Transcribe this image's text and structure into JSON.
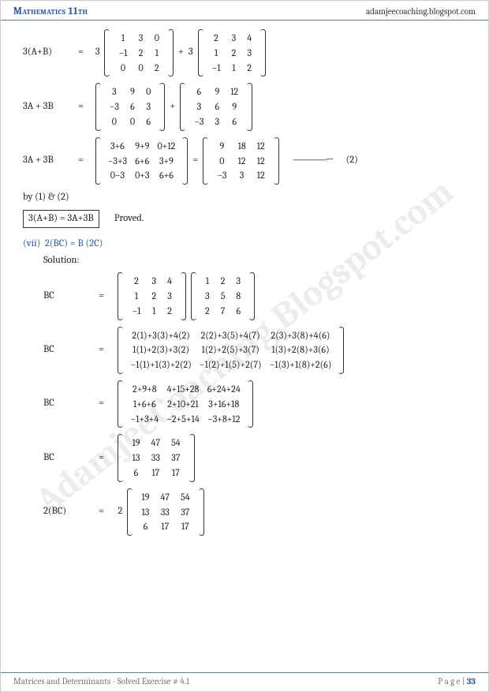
{
  "header": {
    "left": "Mathematics 11th",
    "right": "adamjeecoaching.blogspot.com"
  },
  "footer": {
    "chapter": "Matrices and Determinants",
    "sub": " - Solved Exercise # 4.1",
    "page_label": "P a g e | ",
    "page_no": "33"
  },
  "watermark": "AdamjeeCoaching.Blogspot.com",
  "eq1": {
    "lhs": "3(A+B)",
    "eq": "=",
    "s1": "3",
    "plus": "+",
    "s2": "3",
    "m1": [
      [
        "1",
        "3",
        "0"
      ],
      [
        "−1",
        "2",
        "1"
      ],
      [
        "0",
        "0",
        "2"
      ]
    ],
    "m2": [
      [
        "2",
        "3",
        "4"
      ],
      [
        "1",
        "2",
        "3"
      ],
      [
        "−1",
        "1",
        "2"
      ]
    ]
  },
  "eq2": {
    "lhs": "3A + 3B",
    "eq": "=",
    "plus": "+",
    "m1": [
      [
        "3",
        "9",
        "0"
      ],
      [
        "−3",
        "6",
        "3"
      ],
      [
        "0",
        "0",
        "6"
      ]
    ],
    "m2": [
      [
        "6",
        "9",
        "12"
      ],
      [
        "3",
        "6",
        "9"
      ],
      [
        "−3",
        "3",
        "6"
      ]
    ]
  },
  "eq3": {
    "lhs": "3A + 3B",
    "eq": "=",
    "eq2": "=",
    "arrow": "————→",
    "num": "(2)",
    "m1": [
      [
        "3+6",
        "9+9",
        "0+12"
      ],
      [
        "−3+3",
        "6+6",
        "3+9"
      ],
      [
        "0−3",
        "0+3",
        "6+6"
      ]
    ],
    "m2": [
      [
        "9",
        "18",
        "12"
      ],
      [
        "0",
        "12",
        "12"
      ],
      [
        "−3",
        "3",
        "12"
      ]
    ]
  },
  "line_by": "by (1) & (2)",
  "boxed": "3(A+B) = 3A+3B",
  "proved": "Proved.",
  "part": {
    "num": "(vii)",
    "stmt": "2(BC)  =  B (2C)",
    "sol": "Solution:"
  },
  "bc1": {
    "lhs": "BC",
    "eq": "=",
    "m1": [
      [
        "2",
        "3",
        "4"
      ],
      [
        "1",
        "2",
        "3"
      ],
      [
        "−1",
        "1",
        "2"
      ]
    ],
    "m2": [
      [
        "1",
        "2",
        "3"
      ],
      [
        "3",
        "5",
        "8"
      ],
      [
        "2",
        "7",
        "6"
      ]
    ]
  },
  "bc2": {
    "lhs": "BC",
    "eq": "=",
    "m": [
      [
        "2(1)+3(3)+4(2)",
        "2(2)+3(5)+4(7)",
        "2(3)+3(8)+4(6)"
      ],
      [
        "1(1)+2(3)+3(2)",
        "1(2)+2(5)+3(7)",
        "1(3)+2(8)+3(6)"
      ],
      [
        "−1(1)+1(3)+2(2)",
        "−1(2)+1(5)+2(7)",
        "−1(3)+1(8)+2(6)"
      ]
    ]
  },
  "bc3": {
    "lhs": "BC",
    "eq": "=",
    "m": [
      [
        "2+9+8",
        "4+15+28",
        "6+24+24"
      ],
      [
        "1+6+6",
        "2+10+21",
        "3+16+18"
      ],
      [
        "−1+3+4",
        "−2+5+14",
        "−3+8+12"
      ]
    ]
  },
  "bc4": {
    "lhs": "BC",
    "eq": "=",
    "m": [
      [
        "19",
        "47",
        "54"
      ],
      [
        "13",
        "33",
        "37"
      ],
      [
        "6",
        "17",
        "17"
      ]
    ]
  },
  "bc5": {
    "lhs": "2(BC)",
    "eq": "=",
    "s": "2",
    "m": [
      [
        "19",
        "47",
        "54"
      ],
      [
        "13",
        "33",
        "37"
      ],
      [
        "6",
        "17",
        "17"
      ]
    ]
  }
}
